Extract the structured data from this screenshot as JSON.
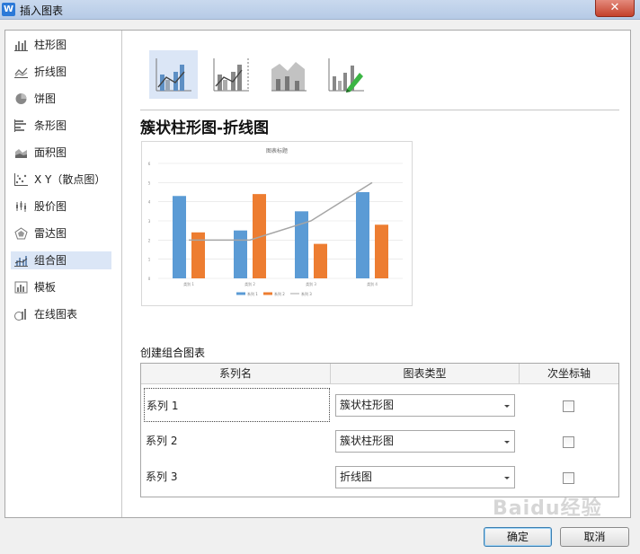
{
  "window": {
    "title": "插入图表",
    "app_icon": "W",
    "close_label": "✕"
  },
  "sidebar": {
    "items": [
      {
        "label": "柱形图",
        "icon": "bar-chart-icon"
      },
      {
        "label": "折线图",
        "icon": "line-chart-icon"
      },
      {
        "label": "饼图",
        "icon": "pie-chart-icon"
      },
      {
        "label": "条形图",
        "icon": "horizontal-bar-chart-icon"
      },
      {
        "label": "面积图",
        "icon": "area-chart-icon"
      },
      {
        "label": "X Y（散点图）",
        "icon": "scatter-chart-icon"
      },
      {
        "label": "股价图",
        "icon": "stock-chart-icon"
      },
      {
        "label": "雷达图",
        "icon": "radar-chart-icon"
      },
      {
        "label": "组合图",
        "icon": "combo-chart-icon",
        "active": true
      },
      {
        "label": "模板",
        "icon": "template-icon"
      },
      {
        "label": "在线图表",
        "icon": "online-chart-icon"
      }
    ]
  },
  "main": {
    "chart_title": "簇状柱形图-折线图",
    "section_label": "创建组合图表",
    "table": {
      "headers": [
        "系列名",
        "图表类型",
        "次坐标轴"
      ],
      "rows": [
        {
          "name": "系列 1",
          "type": "簇状柱形图",
          "secondary": false
        },
        {
          "name": "系列 2",
          "type": "簇状柱形图",
          "secondary": false
        },
        {
          "name": "系列 3",
          "type": "折线图",
          "secondary": false
        }
      ]
    }
  },
  "preview": {
    "title": "图表标题",
    "yticks": [
      "6",
      "5",
      "4",
      "3",
      "2",
      "1",
      "0"
    ],
    "categories": [
      "类别 1",
      "类别 2",
      "类别 3",
      "类别 4"
    ],
    "legend": [
      "系列 1",
      "系列 2",
      "系列 3"
    ]
  },
  "chart_data": {
    "type": "bar",
    "title": "图表标题",
    "categories": [
      "类别 1",
      "类别 2",
      "类别 3",
      "类别 4"
    ],
    "ylim": [
      0,
      6
    ],
    "series": [
      {
        "name": "系列 1",
        "type": "bar",
        "values": [
          4.3,
          2.5,
          3.5,
          4.5
        ],
        "color": "#5b9bd5"
      },
      {
        "name": "系列 2",
        "type": "bar",
        "values": [
          2.4,
          4.4,
          1.8,
          2.8
        ],
        "color": "#ed7d31"
      },
      {
        "name": "系列 3",
        "type": "line",
        "values": [
          2,
          2,
          3,
          5
        ],
        "color": "#a5a5a5"
      }
    ],
    "legend": "bottom"
  },
  "buttons": {
    "ok": "确定",
    "cancel": "取消"
  },
  "watermark": "Baidu经验",
  "colors": {
    "selected_bg": "#dbe6f6",
    "bar1": "#5b9bd5",
    "bar2": "#ed7d31",
    "line": "#a5a5a5"
  }
}
